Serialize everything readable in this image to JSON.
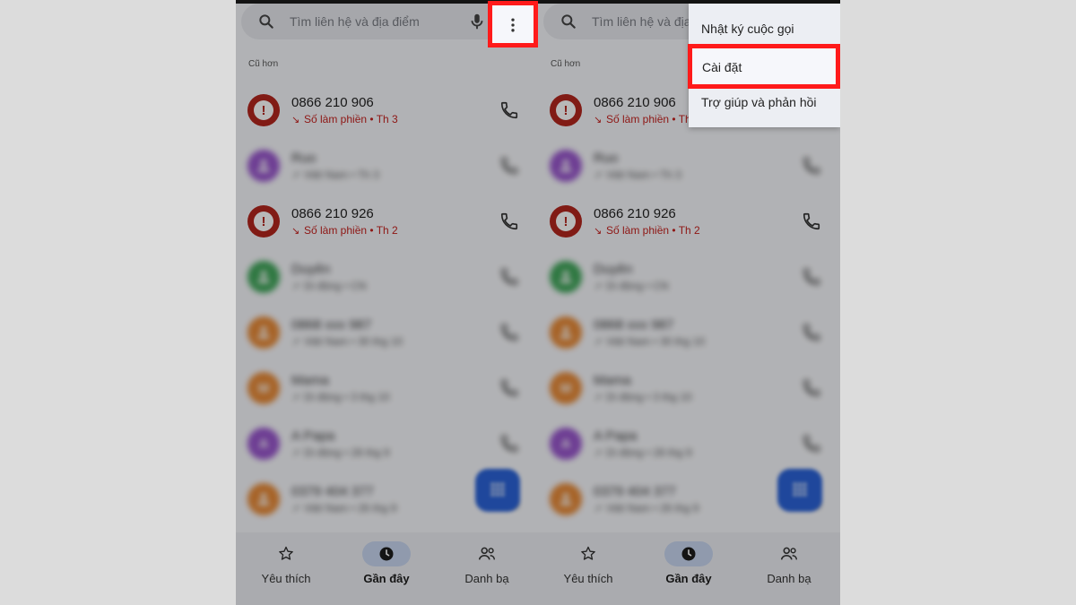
{
  "search": {
    "placeholder": "Tìm liên hệ và địa điểm"
  },
  "section_label": "Cũ hơn",
  "calls": [
    {
      "name": "0866 210 906",
      "detail": "Số làm phiền • Th 3",
      "type": "spam",
      "color": "#b3261e",
      "blurred": false
    },
    {
      "name": "Ruo",
      "detail": "Việt Nam • Th 3",
      "type": "contact",
      "color": "#8e44c8",
      "initial": "",
      "blurred": true
    },
    {
      "name": "0866 210 926",
      "detail": "Số làm phiền • Th 2",
      "type": "spam",
      "color": "#b3261e",
      "blurred": false
    },
    {
      "name": "Duyên",
      "detail": "Di động • CN",
      "type": "contact",
      "color": "#2e9e4a",
      "initial": "",
      "blurred": true
    },
    {
      "name": "0868 xxx 987",
      "detail": "Việt Nam • 30 thg 10",
      "type": "contact",
      "color": "#e67e22",
      "initial": "",
      "blurred": true
    },
    {
      "name": "Mama",
      "detail": "Di động • 3 thg 10",
      "type": "contact",
      "color": "#e67e22",
      "initial": "M",
      "blurred": true
    },
    {
      "name": "A Papa",
      "detail": "Di động • 28 thg 9",
      "type": "contact",
      "color": "#8e44c8",
      "initial": "A",
      "blurred": true
    },
    {
      "name": "0379 404 377",
      "detail": "Việt Nam • 26 thg 9",
      "type": "contact",
      "color": "#e67e22",
      "initial": "",
      "blurred": true
    }
  ],
  "nav": [
    {
      "label": "Yêu thích",
      "icon": "star-icon",
      "active": false
    },
    {
      "label": "Gần đây",
      "icon": "clock-icon",
      "active": true
    },
    {
      "label": "Danh bạ",
      "icon": "people-icon",
      "active": false
    }
  ],
  "menu": {
    "items": [
      "Nhật ký cuộc gọi",
      "Cài đặt",
      "Trợ giúp và phản hồi"
    ],
    "highlighted_index": 1
  },
  "colors": {
    "highlight": "#ff1a1a",
    "fab": "#2b63d8",
    "spam_text": "#c5221f"
  }
}
